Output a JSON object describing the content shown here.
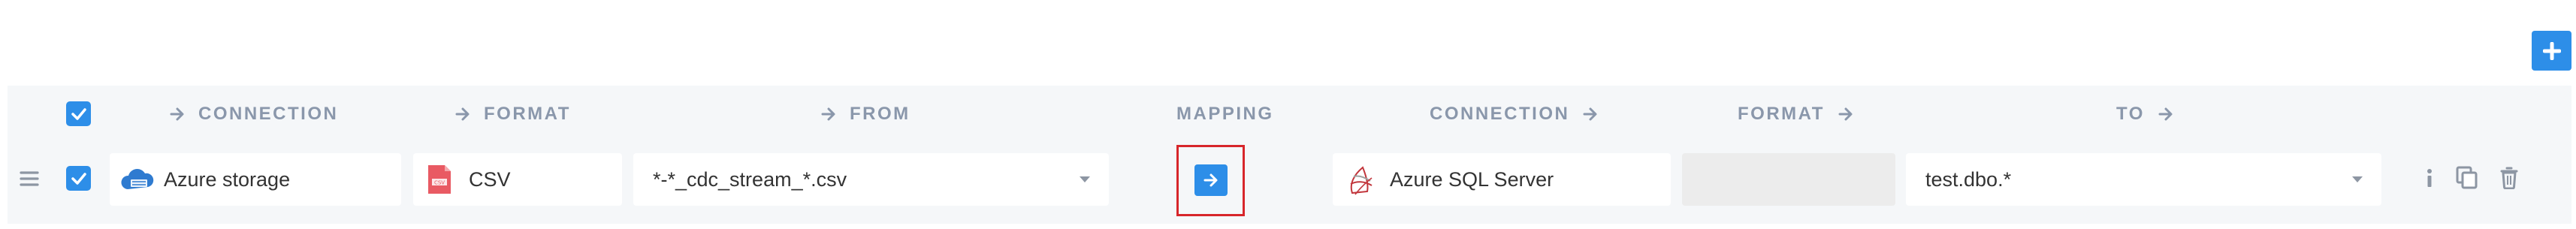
{
  "add_button": {
    "icon": "plus-icon"
  },
  "headers": {
    "source_connection": "CONNECTION",
    "source_format": "FORMAT",
    "from": "FROM",
    "mapping": "MAPPING",
    "dest_connection": "CONNECTION",
    "dest_format": "FORMAT",
    "to": "TO"
  },
  "row": {
    "source_connection": {
      "label": "Azure storage",
      "icon": "azure-cloud-icon"
    },
    "source_format": {
      "label": "CSV",
      "icon": "csv-file-icon"
    },
    "from": {
      "value": "*-*_cdc_stream_*.csv"
    },
    "mapping": {
      "icon": "arrow-right-icon"
    },
    "dest_connection": {
      "label": "Azure SQL Server",
      "icon": "sql-server-icon"
    },
    "dest_format": {
      "value": ""
    },
    "to": {
      "value": "test.dbo.*"
    },
    "actions": [
      "info-icon",
      "copy-icon",
      "trash-icon"
    ]
  },
  "colors": {
    "accent": "#2d8ee8",
    "highlight": "#d7262b",
    "header_text": "#8a97ab",
    "panel": "#f5f7f9"
  }
}
